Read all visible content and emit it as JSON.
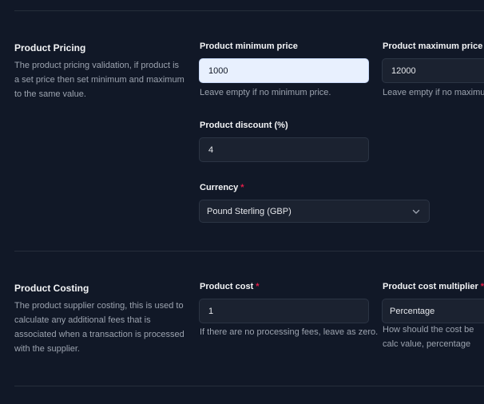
{
  "pricing": {
    "title": "Product Pricing",
    "description": "The product pricing validation, if product is a set price then set minimum and maximum to the same value.",
    "min_price": {
      "label": "Product minimum price",
      "value": "1000",
      "hint": "Leave empty if no minimum price."
    },
    "max_price": {
      "label": "Product maximum price",
      "value": "12000",
      "hint": "Leave empty if no maximum"
    },
    "discount": {
      "label": "Product discount (%)",
      "value": "4"
    },
    "currency": {
      "label": "Currency",
      "required_mark": "*",
      "value": "Pound Sterling (GBP)"
    }
  },
  "costing": {
    "title": "Product Costing",
    "description": "The product supplier costing, this is used to calculate any additional fees that is associated when a transaction is processed with the supplier.",
    "cost": {
      "label": "Product cost",
      "required_mark": "*",
      "value": "1",
      "hint": "If there are no processing fees, leave as zero."
    },
    "multiplier": {
      "label": "Product cost multiplier",
      "required_mark": "*",
      "value": "Percentage",
      "hint": "How should the cost be calc value, percentage etc..."
    }
  },
  "colors": {
    "background": "#111827",
    "input_background": "#1b2230",
    "focused_input_background": "#e8f0fe",
    "required_mark": "#e11d48"
  },
  "icons": {
    "select_chevron": "chevron-down-icon"
  }
}
